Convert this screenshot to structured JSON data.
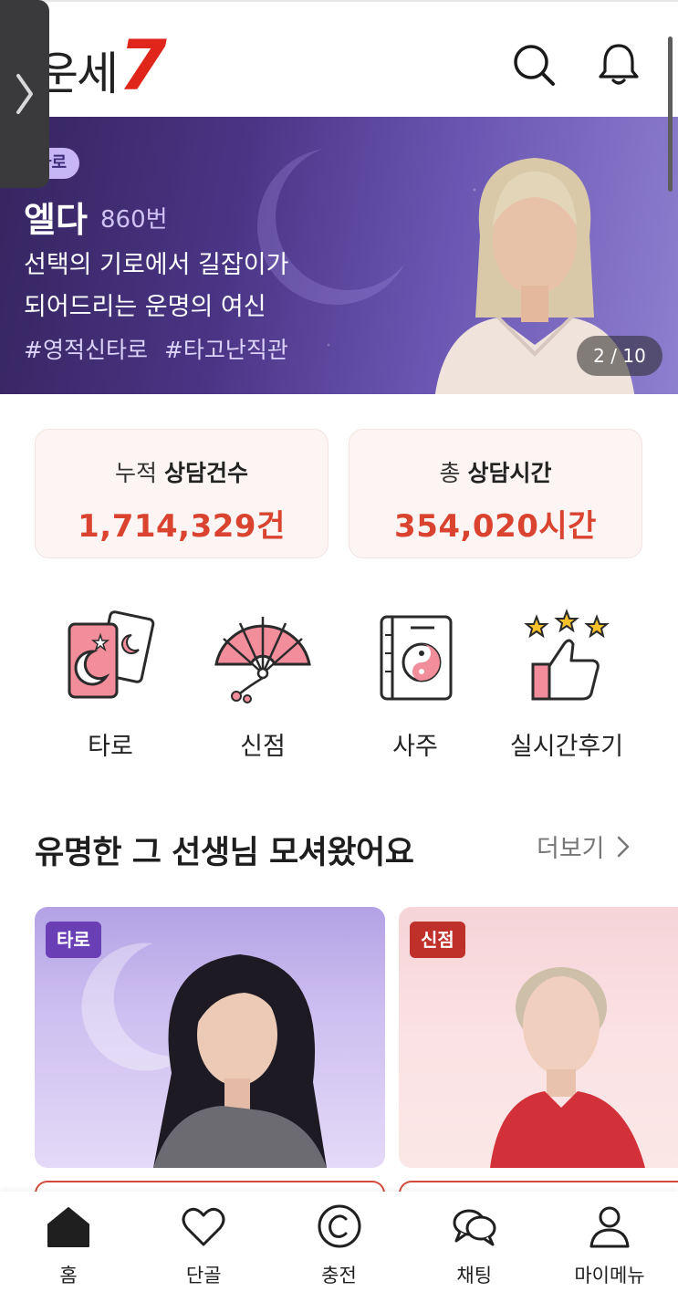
{
  "header": {
    "logo_text": "운세",
    "logo_number": "7",
    "search_icon": "search-icon",
    "bell_icon": "bell-icon"
  },
  "banner": {
    "badge": "타로",
    "name": "엘다",
    "number": "860번",
    "description_line1": "선택의 기로에서 길잡이가",
    "description_line2": "되어드리는 운명의 여신",
    "tags": [
      "#영적신타로",
      "#타고난직관"
    ],
    "counter": "2 / 10"
  },
  "stats": [
    {
      "label_prefix": "누적",
      "label_bold": "상담건수",
      "value": "1,714,329건"
    },
    {
      "label_prefix": "총",
      "label_bold": "상담시간",
      "value": "354,020시간"
    }
  ],
  "categories": [
    {
      "label": "타로",
      "icon": "tarot-cards-icon"
    },
    {
      "label": "신점",
      "icon": "fan-icon"
    },
    {
      "label": "사주",
      "icon": "yin-yang-book-icon"
    },
    {
      "label": "실시간후기",
      "icon": "thumbs-up-stars-icon"
    }
  ],
  "section": {
    "title": "유명한 그 선생님 모셔왔어요",
    "more": "더보기"
  },
  "cards": [
    {
      "badge": "타로",
      "badge_color": "#6a3fb5"
    },
    {
      "badge": "신점",
      "badge_color": "#c0302b"
    }
  ],
  "nav": [
    {
      "label": "홈",
      "icon": "home-icon"
    },
    {
      "label": "단골",
      "icon": "heart-icon"
    },
    {
      "label": "충전",
      "icon": "copyright-coin-icon"
    },
    {
      "label": "채팅",
      "icon": "chat-bubbles-icon"
    },
    {
      "label": "마이메뉴",
      "icon": "person-icon"
    }
  ],
  "colors": {
    "accent_red": "#d9432f",
    "brand_red": "#e0251b",
    "icon_pink": "#f28d9b"
  }
}
